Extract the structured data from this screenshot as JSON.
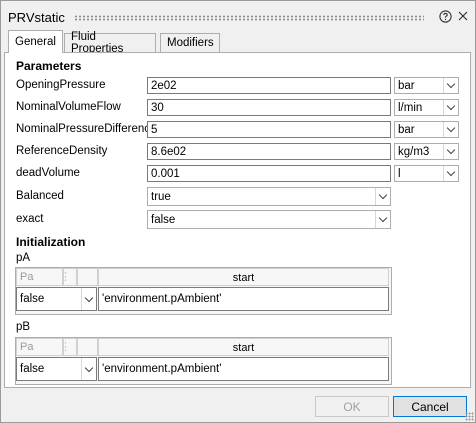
{
  "window": {
    "title": "PRVstatic",
    "help_icon": "question-circle-icon",
    "close_icon": "close-x-icon"
  },
  "tabs": [
    {
      "label": "General",
      "active": true
    },
    {
      "label": "Fluid Properties",
      "active": false
    },
    {
      "label": "Modifiers",
      "active": false
    }
  ],
  "parameters": {
    "heading": "Parameters",
    "rows": [
      {
        "label": "OpeningPressure",
        "value": "2e02",
        "unit": "bar"
      },
      {
        "label": "NominalVolumeFlow",
        "value": "30",
        "unit": "l/min"
      },
      {
        "label": "NominalPressureDifference",
        "value": "5",
        "unit": "bar"
      },
      {
        "label": "ReferenceDensity",
        "value": "8.6e02",
        "unit": "kg/m3"
      },
      {
        "label": "deadVolume",
        "value": "0.001",
        "unit": "l"
      }
    ],
    "booleans": [
      {
        "label": "Balanced",
        "value": "true"
      },
      {
        "label": "exact",
        "value": "false"
      }
    ]
  },
  "initialization": {
    "heading": "Initialization",
    "ports": [
      {
        "label": "pA",
        "col_placeholder": "Pa",
        "col_header": "start",
        "fixed": "false",
        "start": "'environment.pAmbient'"
      },
      {
        "label": "pB",
        "col_placeholder": "Pa",
        "col_header": "start",
        "fixed": "false",
        "start": "'environment.pAmbient'"
      }
    ]
  },
  "buttons": {
    "ok": "OK",
    "cancel": "Cancel"
  },
  "colors": {
    "accent": "#0078d7",
    "border": "#adadad",
    "background": "#f0f0f0"
  }
}
